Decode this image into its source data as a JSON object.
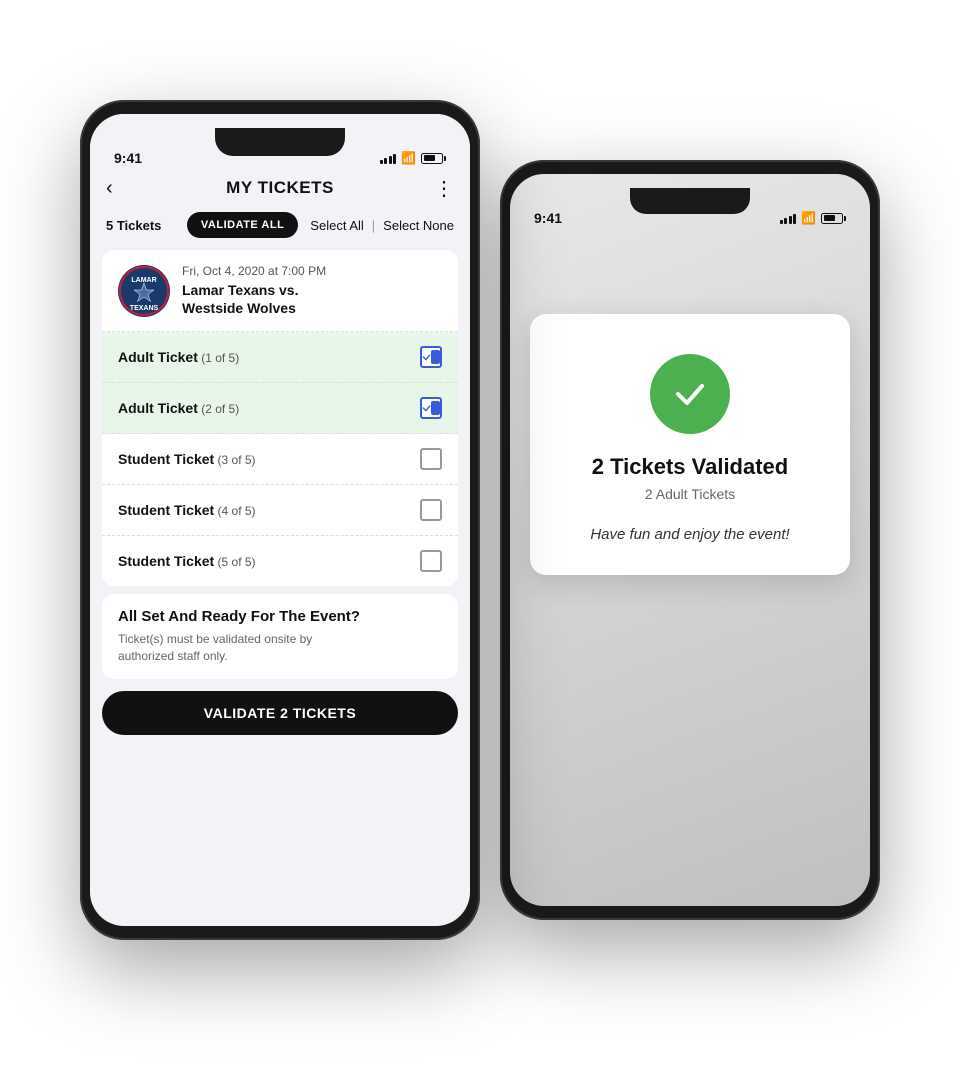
{
  "scene": {
    "bg": "#ffffff"
  },
  "front_phone": {
    "status_bar": {
      "time": "9:41"
    },
    "nav": {
      "back_label": "‹",
      "title": "MY TICKETS",
      "more_label": "⋮"
    },
    "controls": {
      "tickets_count": "5 Tickets",
      "validate_all_label": "VALIDATE ALL",
      "select_all_label": "Select All",
      "divider": "|",
      "select_none_label": "Select None"
    },
    "event": {
      "date": "Fri, Oct 4, 2020 at 7:00 PM",
      "teams": "Lamar Texans vs.\nWestside Wolves"
    },
    "tickets": [
      {
        "name": "Adult Ticket",
        "sub": "(1 of 5)",
        "selected": true
      },
      {
        "name": "Adult Ticket",
        "sub": "(2 of 5)",
        "selected": true
      },
      {
        "name": "Student Ticket",
        "sub": "(3 of 5)",
        "selected": false
      },
      {
        "name": "Student Ticket",
        "sub": "(4 of 5)",
        "selected": false
      },
      {
        "name": "Student Ticket",
        "sub": "(5 of 5)",
        "selected": false
      }
    ],
    "bottom": {
      "title": "All Set And Ready For The Event?",
      "desc": "Ticket(s) must be validated onsite by\nauthorized staff only."
    },
    "validate_btn_label": "VALIDATE 2 TICKETS"
  },
  "back_phone": {
    "status_bar": {
      "time": "9:41"
    },
    "validated": {
      "count_label": "2 Tickets Validated",
      "type_label": "2 Adult Tickets",
      "message": "Have fun and enjoy the event!"
    }
  }
}
